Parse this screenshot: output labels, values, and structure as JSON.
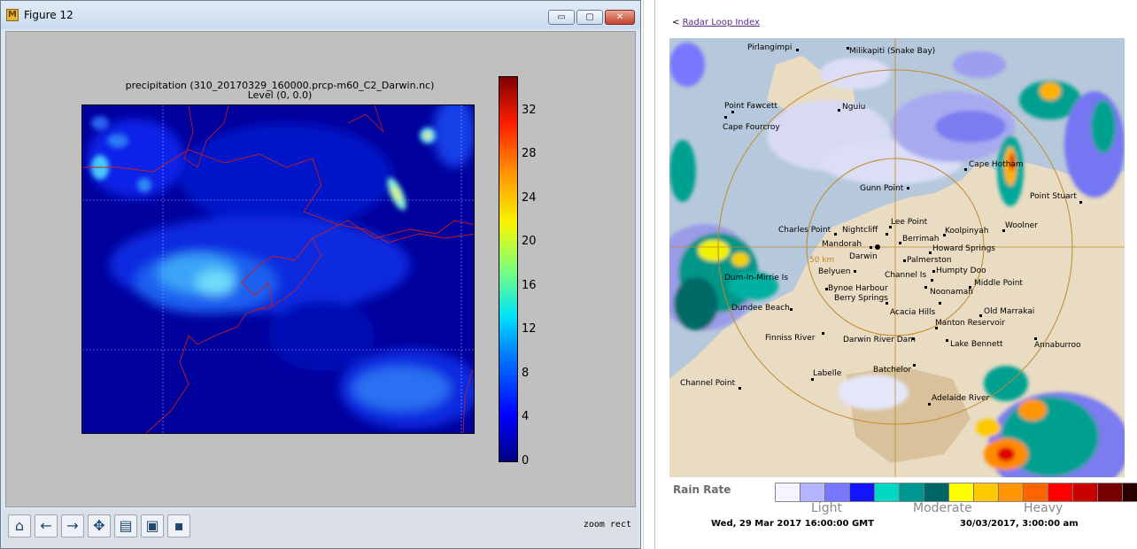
{
  "window": {
    "title": "Figure 12",
    "controls": {
      "minimize": "▭",
      "maximize": "▢",
      "close": "✕"
    }
  },
  "plot": {
    "title_line1": "precipitation (310_20170329_160000.prcp-m60_C2_Darwin.nc)",
    "title_line2": "Level  (0, 0.0)",
    "colorbar_ticks": [
      "32",
      "28",
      "24",
      "20",
      "16",
      "12",
      "8",
      "4",
      "0"
    ]
  },
  "toolbar": {
    "buttons": [
      {
        "name": "home-button",
        "glyph": "⌂"
      },
      {
        "name": "back-button",
        "glyph": "←"
      },
      {
        "name": "forward-button",
        "glyph": "→"
      },
      {
        "name": "pan-button",
        "glyph": "✥"
      },
      {
        "name": "configure-subplots-button",
        "glyph": "▤"
      },
      {
        "name": "zoom-rect-button",
        "glyph": "▣"
      },
      {
        "name": "save-button",
        "glyph": "▪"
      }
    ],
    "status": "zoom rect"
  },
  "radar": {
    "back_link_prefix": "<",
    "back_link": "Radar Loop Index",
    "places": [
      "Pirlangimpi",
      "Milikapiti (Snake Bay)",
      "Point Fawcett",
      "Nguiu",
      "Cape Fourcroy",
      "Cape Hotham",
      "Gunn Point",
      "Point Stuart",
      "Lee Point",
      "Woolner",
      "Charles Point",
      "Nightcliff",
      "Koolpinyah",
      "Berrimah",
      "Mandorah",
      "Howard Springs",
      "Darwin",
      "Palmerston",
      "50 km",
      "Belyuen",
      "Channel Is",
      "Humpty Doo",
      "Dum-In-Mirrie Is",
      "Middle Point",
      "Bynoe Harbour",
      "Noonamah",
      "Berry Springs",
      "Acacia Hills",
      "Dundee Beach",
      "Old Marrakai",
      "Manton Reservoir",
      "Finniss River",
      "Darwin River Dam",
      "Lake Bennett",
      "Annaburroo",
      "Labelle",
      "Batchelor",
      "Channel Point",
      "Adelaide River"
    ],
    "legend": {
      "label": "Rain Rate",
      "light": "Light",
      "moderate": "Moderate",
      "heavy": "Heavy",
      "colors": [
        "#f5f5ff",
        "#b4b4ff",
        "#7878ff",
        "#1414ff",
        "#00d8c3",
        "#009690",
        "#006666",
        "#ffff00",
        "#ffc800",
        "#ff9600",
        "#ff6400",
        "#ff0000",
        "#c80000",
        "#780000",
        "#280000"
      ]
    },
    "time_utc": "Wed, 29 Mar 2017 16:00:00 GMT",
    "time_local": "30/03/2017, 3:00:00 am"
  }
}
